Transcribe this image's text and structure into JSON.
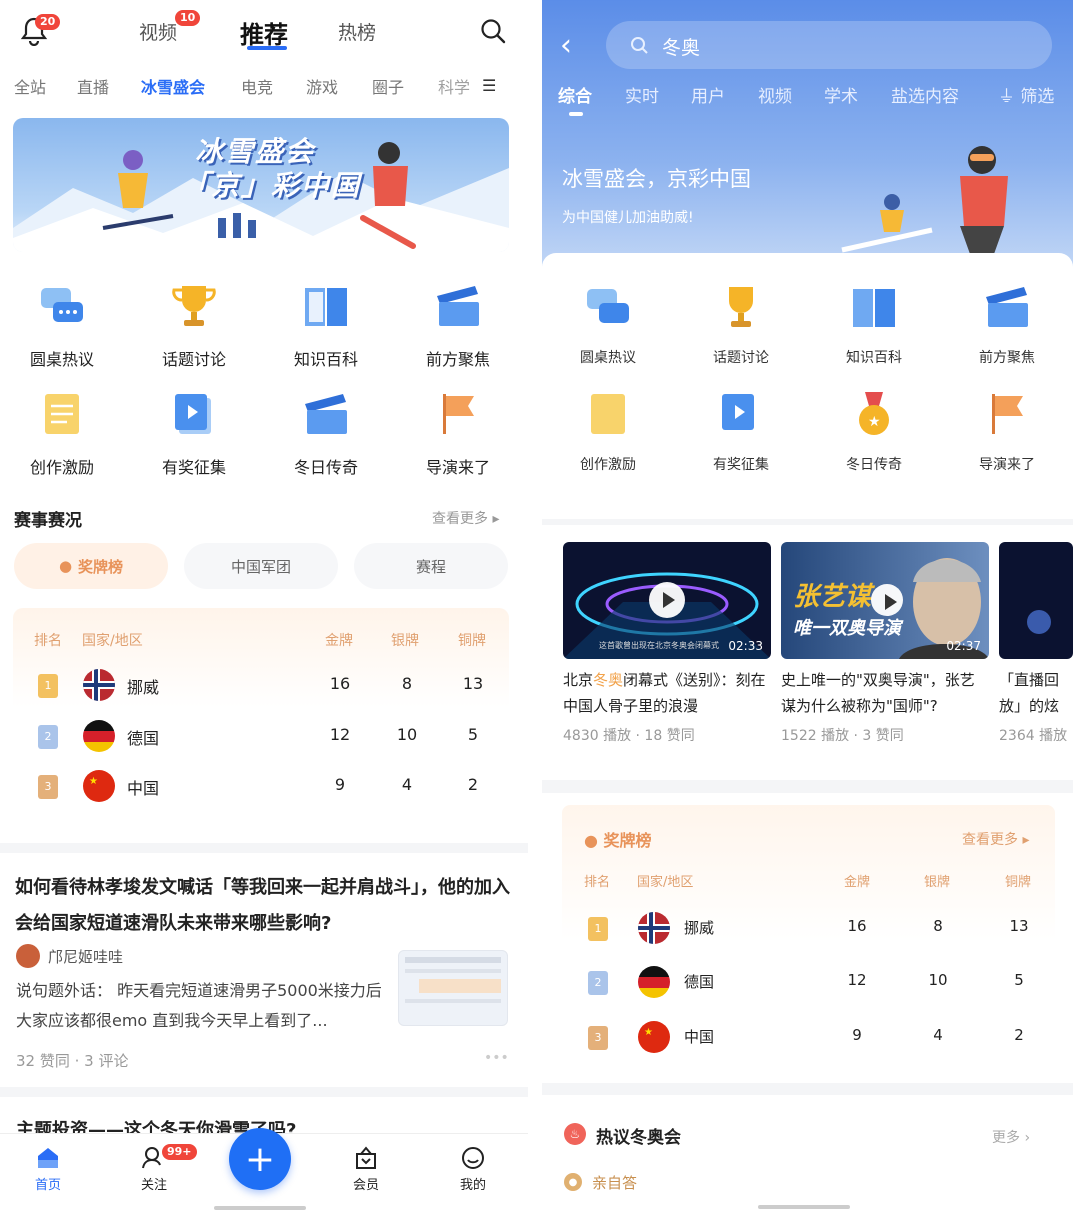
{
  "left": {
    "notif_badge": "20",
    "tabs": [
      {
        "label": "视频",
        "badge": "10"
      },
      {
        "label": "推荐"
      },
      {
        "label": "热榜"
      }
    ],
    "channels": [
      "全站",
      "直播",
      "冰雪盛会",
      "电竞",
      "游戏",
      "圈子",
      "科学"
    ],
    "banner": {
      "line1": "冰雪盛会",
      "line2": "「京」彩中国"
    },
    "grid": [
      "圆桌热议",
      "话题讨论",
      "知识百科",
      "前方聚焦",
      "创作激励",
      "有奖征集",
      "冬日传奇",
      "导演来了"
    ],
    "section_title": "赛事赛况",
    "section_more": "查看更多",
    "pills": [
      "奖牌榜",
      "中国军团",
      "赛程"
    ],
    "table_headers": [
      "排名",
      "国家/地区",
      "金牌",
      "银牌",
      "铜牌"
    ],
    "rows": [
      {
        "rank": "1",
        "country": "挪威",
        "gold": "16",
        "silver": "8",
        "bronze": "13"
      },
      {
        "rank": "2",
        "country": "德国",
        "gold": "12",
        "silver": "10",
        "bronze": "5"
      },
      {
        "rank": "3",
        "country": "中国",
        "gold": "9",
        "silver": "4",
        "bronze": "2"
      }
    ],
    "post": {
      "title": "如何看待林孝埈发文喊话「等我回来一起并肩战斗」，他的加入会给国家短道速滑队未来带来哪些影响?",
      "author": "邝尼姬哇哇",
      "excerpt": "说句题外话：  昨天看完短道速滑男子5000米接力后大家应该都很emo 直到我今天早上看到了...",
      "meta": "32 赞同 · 3 评论"
    },
    "next_title": "主题投资——这个冬天你滑雪了吗?",
    "bottom": [
      {
        "label": "首页"
      },
      {
        "label": "关注",
        "badge": "99+"
      },
      {
        "label": "会员"
      },
      {
        "label": "我的"
      }
    ]
  },
  "right": {
    "search": "冬奥",
    "tabs": [
      "综合",
      "实时",
      "用户",
      "视频",
      "学术",
      "盐选内容"
    ],
    "filter": "筛选",
    "hero_title": "冰雪盛会，京彩中国",
    "hero_sub": "为中国健儿加油助威!",
    "grid": [
      "圆桌热议",
      "话题讨论",
      "知识百科",
      "前方聚焦",
      "创作激励",
      "有奖征集",
      "冬日传奇",
      "导演来了"
    ],
    "videos": [
      {
        "title_pre": "北京",
        "title_hl": "冬奥",
        "title_post": "闭幕式《送别》：刻在中国人骨子里的浪漫",
        "duration": "02:33",
        "caption": "这首歌曾出现在北京冬奥会闭幕式",
        "meta": "4830 播放 · 18 赞同"
      },
      {
        "title": "史上唯一的\"双奥导演\"，张艺谋为什么被称为\"国师\"?",
        "duration": "02:37",
        "overlay1": "张艺谋",
        "overlay2": "唯一双奥导演",
        "meta": "1522 播放 · 3 赞同"
      },
      {
        "title": "「直播回放」的炫酷特效",
        "meta": "2364 播放"
      }
    ],
    "medal_title": "奖牌榜",
    "medal_more": "查看更多",
    "table_headers": [
      "排名",
      "国家/地区",
      "金牌",
      "银牌",
      "铜牌"
    ],
    "rows": [
      {
        "rank": "1",
        "country": "挪威",
        "gold": "16",
        "silver": "8",
        "bronze": "13"
      },
      {
        "rank": "2",
        "country": "德国",
        "gold": "12",
        "silver": "10",
        "bronze": "5"
      },
      {
        "rank": "3",
        "country": "中国",
        "gold": "9",
        "silver": "4",
        "bronze": "2"
      }
    ],
    "hot_title": "热议冬奥会",
    "hot_more": "更多",
    "hot_item": "亲自答"
  }
}
